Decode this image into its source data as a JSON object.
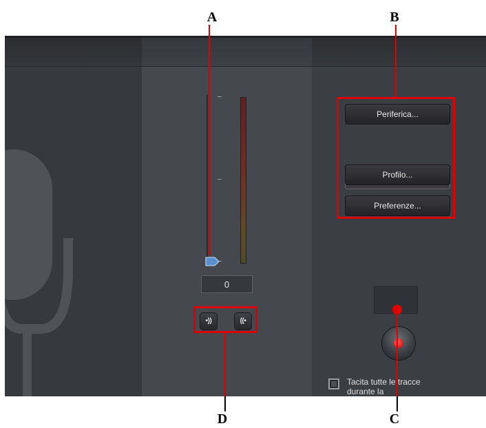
{
  "callouts": {
    "a": "A",
    "b": "B",
    "c": "C",
    "d": "D"
  },
  "recorder": {
    "volume_value": "0",
    "monitor_buttons": [
      {
        "label": "•))",
        "icon": "speaker-monitor-icon"
      },
      {
        "label": "((•",
        "icon": "broadcast-monitor-icon"
      }
    ],
    "device_button_label": "Periferica...",
    "profile_button_label": "Profilo...",
    "preferences_button_label": "Preferenze...",
    "mute_checkbox_label": "Tacita tutte le tracce\ndurante la\nregistrazione",
    "mute_checked": false,
    "record_icon": "record-icon",
    "mic_icon": "microphone-icon"
  },
  "colors": {
    "annotation_red": "#e00000",
    "record_red": "#e00000",
    "panel_dark": "#2f3236",
    "panel_mid": "#45484c"
  }
}
